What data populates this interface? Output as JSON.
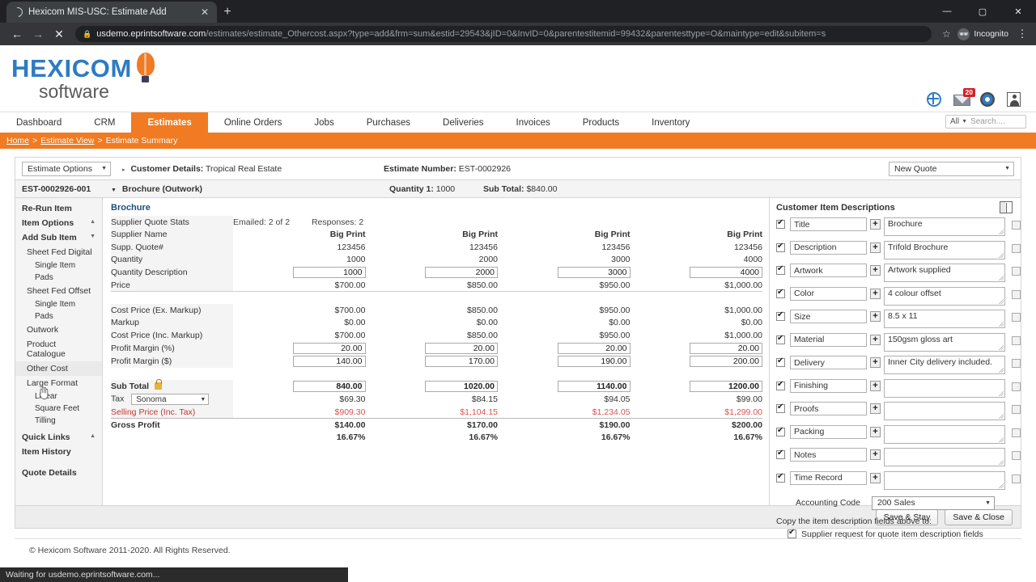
{
  "browser": {
    "tab_title": "Hexicom MIS-USC: Estimate Add",
    "new_tab_label": "+",
    "close_tab_label": "✕",
    "back_label": "←",
    "forward_label": "→",
    "stop_label": "✕",
    "url_host": "usdemo.eprintsoftware.com",
    "url_path": "/estimates/estimate_Othercost.aspx?type=add&frm=sum&estid=29543&jID=0&InvID=0&parentestitemid=99432&parentesttype=O&maintype=edit&subitem=s",
    "star_label": "☆",
    "profile_label": "Incognito",
    "menu_label": "⋮",
    "minimize_label": "—",
    "maximize_label": "▢",
    "close_label": "✕",
    "status_text": "Waiting for usdemo.eprintsoftware.com..."
  },
  "header": {
    "logo_primary": "HEXICOM",
    "logo_secondary": "software",
    "mail_badge": "20"
  },
  "nav": {
    "items": [
      {
        "label": "Dashboard",
        "active": false
      },
      {
        "label": "CRM",
        "active": false
      },
      {
        "label": "Estimates",
        "active": true
      },
      {
        "label": "Online Orders",
        "active": false
      },
      {
        "label": "Jobs",
        "active": false
      },
      {
        "label": "Purchases",
        "active": false
      },
      {
        "label": "Deliveries",
        "active": false
      },
      {
        "label": "Invoices",
        "active": false
      },
      {
        "label": "Products",
        "active": false
      },
      {
        "label": "Inventory",
        "active": false
      }
    ],
    "search_scope": "All",
    "search_placeholder": "Search...."
  },
  "breadcrumb": {
    "home": "Home",
    "sep1": ">",
    "level2": "Estimate View",
    "sep2": ">",
    "current": "Estimate Summary"
  },
  "options_row": {
    "estimate_options": "Estimate Options",
    "customer_label": "Customer Details:",
    "customer_value": "Tropical Real Estate",
    "estimate_number_label": "Estimate Number:",
    "estimate_number_value": "EST-0002926",
    "quote_type": "New Quote"
  },
  "item_row": {
    "item_code": "EST-0002926-001",
    "item_name": "Brochure (Outwork)",
    "quantity_label": "Quantity 1:",
    "quantity_value": "1000",
    "subtotal_label": "Sub Total:",
    "subtotal_value": "$840.00"
  },
  "sidebar": {
    "items": [
      {
        "label": "Re-Run Item",
        "type": "head",
        "arrow": ""
      },
      {
        "label": "Item Options",
        "type": "head",
        "arrow": "▲"
      },
      {
        "label": "Add Sub Item",
        "type": "head",
        "arrow": "▼"
      },
      {
        "label": "Sheet Fed Digital",
        "type": "sub1"
      },
      {
        "label": "Single Item",
        "type": "sub2"
      },
      {
        "label": "Pads",
        "type": "sub2"
      },
      {
        "label": "Sheet Fed Offset",
        "type": "sub1"
      },
      {
        "label": "Single Item",
        "type": "sub2"
      },
      {
        "label": "Pads",
        "type": "sub2"
      },
      {
        "label": "Outwork",
        "type": "sub1"
      },
      {
        "label": "Product Catalogue",
        "type": "sub1"
      },
      {
        "label": "Other Cost",
        "type": "sub1",
        "highlight": true
      },
      {
        "label": "Large Format",
        "type": "sub1"
      },
      {
        "label": "Linear",
        "type": "sub2"
      },
      {
        "label": "Square Feet",
        "type": "sub2"
      },
      {
        "label": "Tilling",
        "type": "sub2"
      },
      {
        "label": "Quick Links",
        "type": "head",
        "arrow": "▲"
      },
      {
        "label": "Item History",
        "type": "head",
        "arrow": ""
      },
      {
        "label": "Quote Details",
        "type": "head",
        "arrow": "",
        "gap_before": true
      }
    ]
  },
  "estimate_table": {
    "title": "Brochure",
    "row_labels": {
      "supplier_quote_stats": "Supplier Quote Stats",
      "supplier_name": "Supplier Name",
      "supp_quote_num": "Supp. Quote#",
      "quantity": "Quantity",
      "quantity_description": "Quantity Description",
      "price": "Price",
      "cost_price_ex": "Cost Price (Ex. Markup)",
      "markup": "Markup",
      "cost_price_inc": "Cost Price (Inc. Markup)",
      "profit_margin_pct": "Profit Margin (%)",
      "profit_margin_dollar": "Profit Margin ($)",
      "sub_total": "Sub Total",
      "tax": "Tax",
      "selling_price": "Selling Price (Inc. Tax)",
      "gross_profit": "Gross Profit"
    },
    "stats": {
      "emailed": "Emailed: 2 of 2",
      "responses": "Responses: 2"
    },
    "tax_selected": "Sonoma",
    "columns": [
      {
        "supplier_name": "Big Print",
        "supp_quote_num": "123456",
        "quantity": "1000",
        "quantity_description": "1000",
        "price": "$700.00",
        "cost_price_ex": "$700.00",
        "markup": "$0.00",
        "cost_price_inc": "$700.00",
        "profit_margin_pct": "20.00",
        "profit_margin_dollar": "140.00",
        "sub_total": "840.00",
        "tax": "$69.30",
        "selling_price": "$909.30",
        "gross_profit": "$140.00",
        "gross_profit_pct": "16.67%"
      },
      {
        "supplier_name": "Big Print",
        "supp_quote_num": "123456",
        "quantity": "2000",
        "quantity_description": "2000",
        "price": "$850.00",
        "cost_price_ex": "$850.00",
        "markup": "$0.00",
        "cost_price_inc": "$850.00",
        "profit_margin_pct": "20.00",
        "profit_margin_dollar": "170.00",
        "sub_total": "1020.00",
        "tax": "$84.15",
        "selling_price": "$1,104.15",
        "gross_profit": "$170.00",
        "gross_profit_pct": "16.67%"
      },
      {
        "supplier_name": "Big Print",
        "supp_quote_num": "123456",
        "quantity": "3000",
        "quantity_description": "3000",
        "price": "$950.00",
        "cost_price_ex": "$950.00",
        "markup": "$0.00",
        "cost_price_inc": "$950.00",
        "profit_margin_pct": "20.00",
        "profit_margin_dollar": "190.00",
        "sub_total": "1140.00",
        "tax": "$94.05",
        "selling_price": "$1,234.05",
        "gross_profit": "$190.00",
        "gross_profit_pct": "16.67%"
      },
      {
        "supplier_name": "Big Print",
        "supp_quote_num": "123456",
        "quantity": "4000",
        "quantity_description": "4000",
        "price": "$1,000.00",
        "cost_price_ex": "$1,000.00",
        "markup": "$0.00",
        "cost_price_inc": "$1,000.00",
        "profit_margin_pct": "20.00",
        "profit_margin_dollar": "200.00",
        "sub_total": "1200.00",
        "tax": "$99.00",
        "selling_price": "$1,299.00",
        "gross_profit": "$200.00",
        "gross_profit_pct": "16.67%"
      }
    ]
  },
  "descriptions": {
    "title": "Customer Item Descriptions",
    "rows": [
      {
        "key": "Title",
        "value": "Brochure",
        "checked": true,
        "plus": "+"
      },
      {
        "key": "Description",
        "value": "Trifold Brochure",
        "checked": true,
        "plus": "+"
      },
      {
        "key": "Artwork",
        "value": "Artwork supplied",
        "checked": true,
        "plus": "+"
      },
      {
        "key": "Color",
        "value": "4 colour offset",
        "checked": true,
        "plus": "+"
      },
      {
        "key": "Size",
        "value": "8.5 x 11",
        "checked": true,
        "plus": "+"
      },
      {
        "key": "Material",
        "value": "150gsm gloss art",
        "checked": true,
        "plus": "+"
      },
      {
        "key": "Delivery",
        "value": "Inner City delivery included.",
        "checked": true,
        "plus": "+"
      },
      {
        "key": "Finishing",
        "value": "",
        "checked": true,
        "plus": "+"
      },
      {
        "key": "Proofs",
        "value": "",
        "checked": true,
        "plus": "+"
      },
      {
        "key": "Packing",
        "value": "",
        "checked": true,
        "plus": "+"
      },
      {
        "key": "Notes",
        "value": "",
        "checked": true,
        "plus": "+"
      },
      {
        "key": "Time Record",
        "value": "",
        "checked": true,
        "plus": "+"
      }
    ],
    "accounting_code_label": "Accounting Code",
    "accounting_code_value": "200 Sales",
    "copy_label": "Copy the item description fields above to:",
    "copy_option": "Supplier request for quote item description fields"
  },
  "footer": {
    "save_stay": "Save & Stay",
    "save_close": "Save & Close",
    "copyright": "© Hexicom Software 2011-2020. All Rights Reserved."
  }
}
